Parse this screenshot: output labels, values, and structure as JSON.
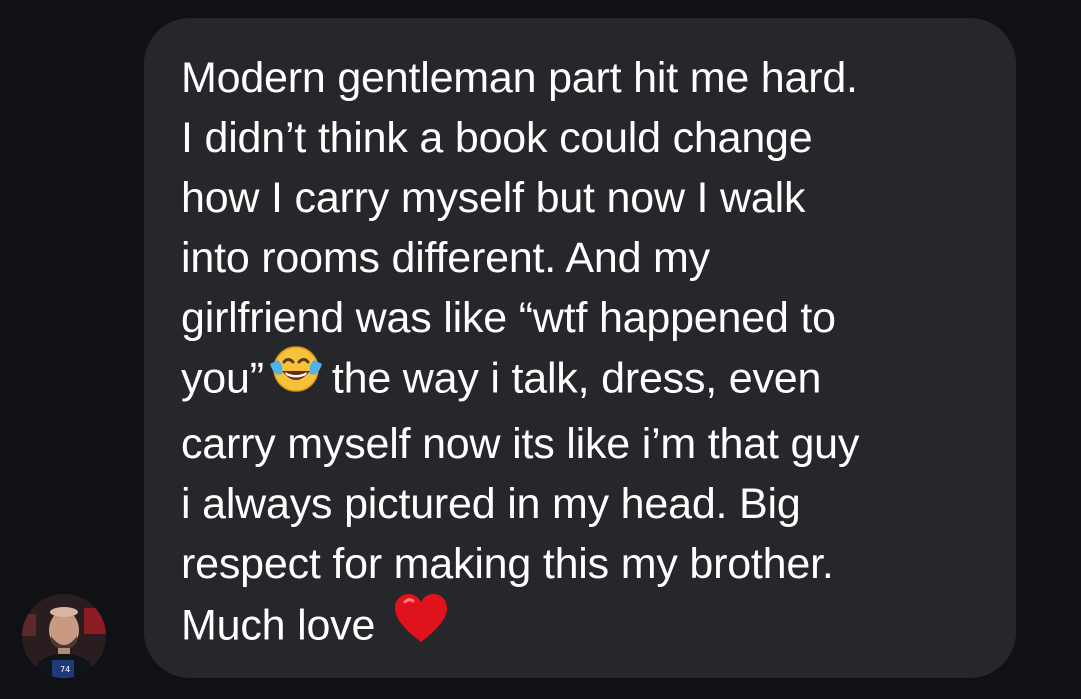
{
  "message": {
    "lines": [
      "Modern gentleman part hit me hard.",
      "I didn’t think a book could change",
      "how I carry myself but now I walk",
      "into rooms different. And my",
      "girlfriend was like “wtf happened to"
    ],
    "line6_before_emoji": "you”",
    "line6_emoji": "face-with-tears-of-joy",
    "line6_after_emoji": "the way i talk, dress, even",
    "lines_after": [
      "carry myself now its like i’m that guy",
      "i always pictured in my head. Big",
      "respect for making this my brother."
    ],
    "last_line_text": "Much love",
    "last_line_emoji": "red-heart",
    "bubble_color": "#26272b",
    "text_color": "#ffffff"
  },
  "sender": {
    "avatar_icon": "profile-photo"
  },
  "background_color": "#0f1115"
}
